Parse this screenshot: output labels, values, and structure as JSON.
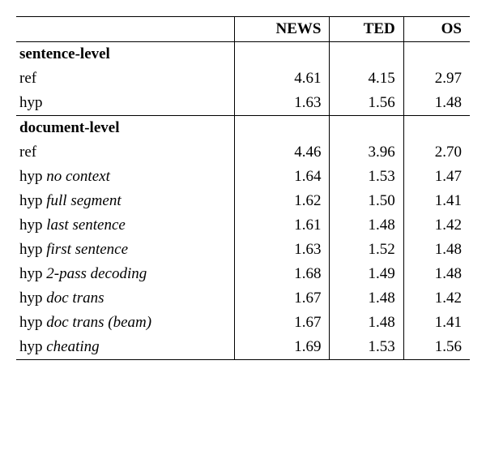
{
  "chart_data": {
    "type": "table",
    "columns": [
      "",
      "NEWS",
      "TED",
      "OS"
    ],
    "sections": [
      {
        "header": "sentence-level",
        "rows": [
          {
            "label": "ref",
            "style": "",
            "values": [
              "4.61",
              "4.15",
              "2.97"
            ]
          },
          {
            "label": "hyp",
            "style": "",
            "values": [
              "1.63",
              "1.56",
              "1.48"
            ]
          }
        ]
      },
      {
        "header": "document-level",
        "rows": [
          {
            "label": "ref",
            "style": "",
            "values": [
              "4.46",
              "3.96",
              "2.70"
            ]
          },
          {
            "label_pre": "hyp ",
            "label_it": "no context",
            "values": [
              "1.64",
              "1.53",
              "1.47"
            ]
          },
          {
            "label_pre": "hyp ",
            "label_it": "full segment",
            "values": [
              "1.62",
              "1.50",
              "1.41"
            ]
          },
          {
            "label_pre": "hyp ",
            "label_it": "last sentence",
            "values": [
              "1.61",
              "1.48",
              "1.42"
            ]
          },
          {
            "label_pre": "hyp ",
            "label_it": "first sentence",
            "values": [
              "1.63",
              "1.52",
              "1.48"
            ]
          },
          {
            "label_pre": "hyp ",
            "label_it": "2-pass decoding",
            "values": [
              "1.68",
              "1.49",
              "1.48"
            ]
          },
          {
            "label_pre": "hyp ",
            "label_it": "doc trans",
            "values": [
              "1.67",
              "1.48",
              "1.42"
            ]
          },
          {
            "label_pre": "hyp ",
            "label_it": "doc trans (beam)",
            "values": [
              "1.67",
              "1.48",
              "1.41"
            ]
          },
          {
            "label_pre": "hyp ",
            "label_it": "cheating",
            "values": [
              "1.69",
              "1.53",
              "1.56"
            ]
          }
        ]
      }
    ]
  },
  "headers": {
    "c0": "",
    "c1": "NEWS",
    "c2": "TED",
    "c3": "OS"
  },
  "section1_header": "sentence-level",
  "s1r0_label": "ref",
  "s1r0_v0": "4.61",
  "s1r0_v1": "4.15",
  "s1r0_v2": "2.97",
  "s1r1_label": "hyp",
  "s1r1_v0": "1.63",
  "s1r1_v1": "1.56",
  "s1r1_v2": "1.48",
  "section2_header": "document-level",
  "s2r0_label": "ref",
  "s2r0_v0": "4.46",
  "s2r0_v1": "3.96",
  "s2r0_v2": "2.70",
  "s2r1_pre": "hyp ",
  "s2r1_it": "no context",
  "s2r1_v0": "1.64",
  "s2r1_v1": "1.53",
  "s2r1_v2": "1.47",
  "s2r2_pre": "hyp ",
  "s2r2_it": "full segment",
  "s2r2_v0": "1.62",
  "s2r2_v1": "1.50",
  "s2r2_v2": "1.41",
  "s2r3_pre": "hyp ",
  "s2r3_it": "last sentence",
  "s2r3_v0": "1.61",
  "s2r3_v1": "1.48",
  "s2r3_v2": "1.42",
  "s2r4_pre": "hyp ",
  "s2r4_it": "first sentence",
  "s2r4_v0": "1.63",
  "s2r4_v1": "1.52",
  "s2r4_v2": "1.48",
  "s2r5_pre": "hyp ",
  "s2r5_it": "2-pass decoding",
  "s2r5_v0": "1.68",
  "s2r5_v1": "1.49",
  "s2r5_v2": "1.48",
  "s2r6_pre": "hyp ",
  "s2r6_it": "doc trans",
  "s2r6_v0": "1.67",
  "s2r6_v1": "1.48",
  "s2r6_v2": "1.42",
  "s2r7_pre": "hyp ",
  "s2r7_it": "doc trans (beam)",
  "s2r7_v0": "1.67",
  "s2r7_v1": "1.48",
  "s2r7_v2": "1.41",
  "s2r8_pre": "hyp ",
  "s2r8_it": "cheating",
  "s2r8_v0": "1.69",
  "s2r8_v1": "1.53",
  "s2r8_v2": "1.56"
}
